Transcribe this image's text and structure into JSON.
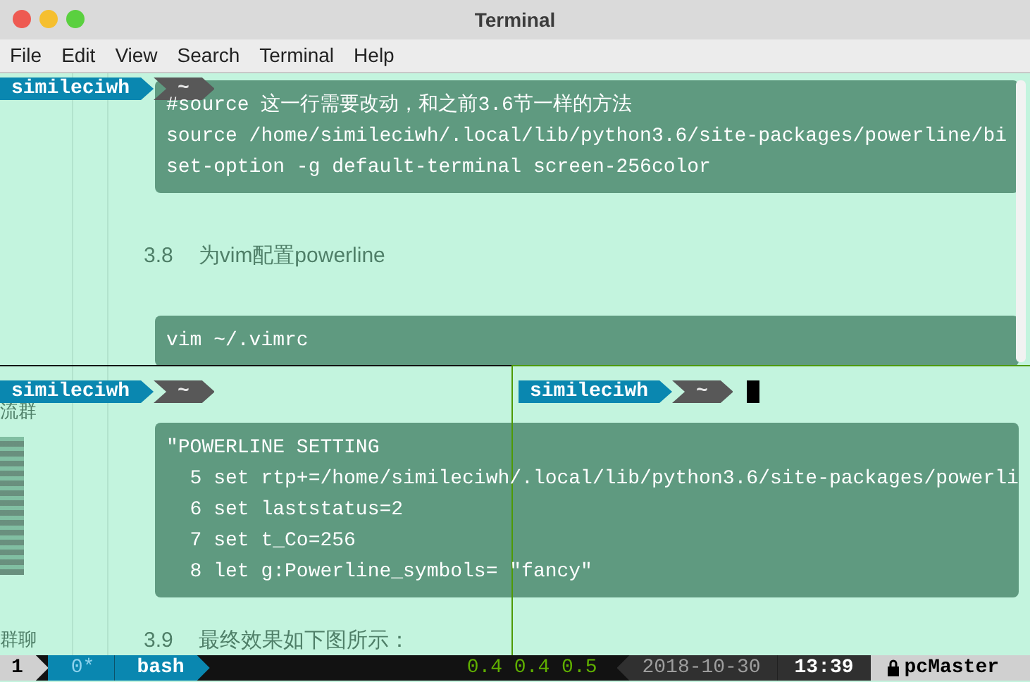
{
  "window": {
    "title": "Terminal"
  },
  "menu": [
    "File",
    "Edit",
    "View",
    "Search",
    "Terminal",
    "Help"
  ],
  "page_behind": {
    "sidebar_texts": [
      "流群",
      "群聊"
    ],
    "blocks": [
      {
        "kind": "code",
        "lines": [
          "#source 这一行需要改动，和之前3.6节一样的方法",
          "source /home/simileciwh/.local/lib/python3.6/site-packages/powerline/bi",
          "set-option -g default-terminal screen-256color"
        ]
      },
      {
        "kind": "heading",
        "number": "3.8",
        "text": "为vim配置powerline"
      },
      {
        "kind": "code",
        "lines": [
          "vim ~/.vimrc"
        ]
      },
      {
        "kind": "code",
        "lines": [
          "\"POWERLINE SETTING",
          "  5 set rtp+=/home/simileciwh/.local/lib/python3.6/site-packages/powerli",
          "  6 set laststatus=2",
          "  7 set t_Co=256",
          "  8 let g:Powerline_symbols= \"fancy\""
        ]
      },
      {
        "kind": "heading",
        "number": "3.9",
        "text": "最终效果如下图所示："
      }
    ]
  },
  "panes": [
    {
      "user": "simileciwh",
      "dir": "~",
      "cursor": false
    },
    {
      "user": "simileciwh",
      "dir": "~",
      "cursor": false
    },
    {
      "user": "simileciwh",
      "dir": "~",
      "cursor": true
    }
  ],
  "status_bar": {
    "session": "1",
    "windows": [
      {
        "label": "0*",
        "selected": false
      },
      {
        "label": "bash",
        "selected": true
      }
    ],
    "load": "0.4 0.4 0.5",
    "date": "2018-10-30",
    "time": "13:39",
    "host": "pcMaster"
  }
}
